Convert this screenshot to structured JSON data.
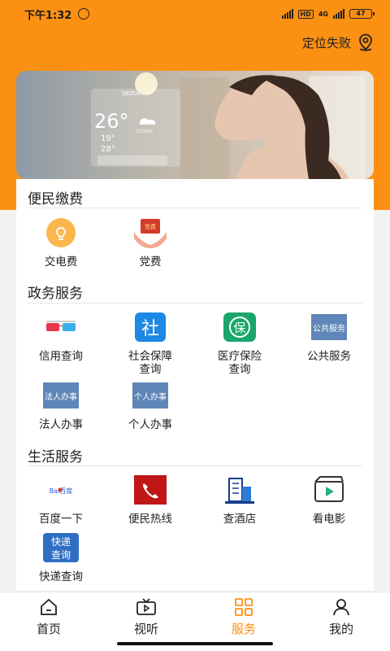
{
  "status_bar": {
    "time": "下午1:32",
    "network": "4G",
    "hd": "HD",
    "battery": "47"
  },
  "header": {
    "location_text": "定位失败"
  },
  "banner": {
    "city": "SEOUL",
    "temperature": "26°",
    "weather": "CLOUDY",
    "low_temp": "19°",
    "high_temp": "28°"
  },
  "sections": [
    {
      "title": "便民缴费",
      "items": [
        {
          "label": "交电费",
          "icon": "bulb-icon"
        },
        {
          "label": "党费",
          "icon": "party-fee-icon"
        }
      ]
    },
    {
      "title": "政务服务",
      "items": [
        {
          "label": "信用查询",
          "icon": "glasses-icon"
        },
        {
          "label": "社会保障\n查询",
          "icon": "social-security-icon",
          "icon_text": "社"
        },
        {
          "label": "医疗保险\n查询",
          "icon": "medical-insurance-icon",
          "icon_text": "保"
        },
        {
          "label": "公共服务",
          "icon": "public-service-icon",
          "icon_text": "公共服务"
        },
        {
          "label": "法人办事",
          "icon": "legal-person-icon",
          "icon_text": "法人办事"
        },
        {
          "label": "个人办事",
          "icon": "personal-affairs-icon",
          "icon_text": "个人办事"
        }
      ]
    },
    {
      "title": "生活服务",
      "items": [
        {
          "label": "百度一下",
          "icon": "baidu-icon",
          "icon_text": "Bai百度"
        },
        {
          "label": "便民热线",
          "icon": "phone-icon"
        },
        {
          "label": "查酒店",
          "icon": "hotel-icon"
        },
        {
          "label": "看电影",
          "icon": "movie-icon"
        },
        {
          "label": "快递查询",
          "icon": "express-icon",
          "icon_text": "快递查询"
        }
      ]
    }
  ],
  "bottom_nav": [
    {
      "label": "首页",
      "icon": "home-icon"
    },
    {
      "label": "视听",
      "icon": "tv-icon"
    },
    {
      "label": "服务",
      "icon": "grid-icon",
      "active": true
    },
    {
      "label": "我的",
      "icon": "user-icon"
    }
  ],
  "colors": {
    "accent": "#fc9012",
    "divider": "#e6e6e6"
  }
}
